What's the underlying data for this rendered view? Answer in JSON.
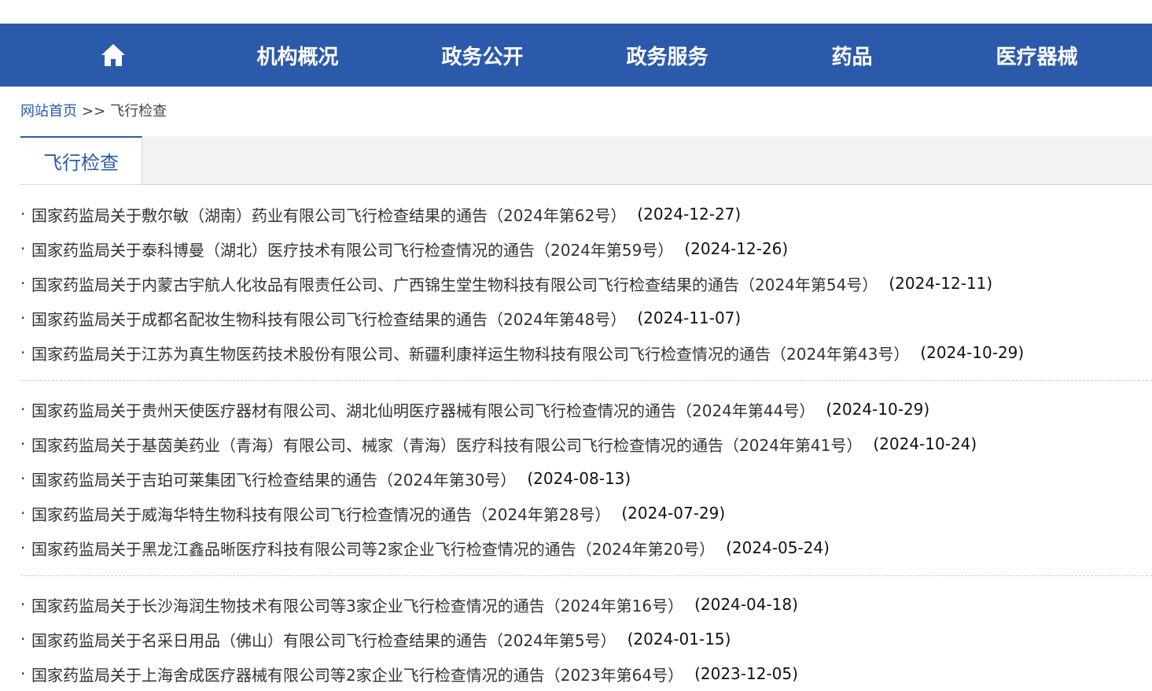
{
  "colors": {
    "accent": "#2c5aab",
    "nav_text": "#ffffff"
  },
  "nav": {
    "home_icon": "home-icon",
    "items": [
      {
        "label": "机构概况"
      },
      {
        "label": "政务公开"
      },
      {
        "label": "政务服务"
      },
      {
        "label": "药品"
      },
      {
        "label": "医疗器械"
      }
    ]
  },
  "breadcrumb": {
    "home": "网站首页",
    "separator": ">>",
    "current": "飞行检查"
  },
  "tab": {
    "label": "飞行检查"
  },
  "groups": [
    {
      "items": [
        {
          "title": "国家药监局关于敷尔敏（湖南）药业有限公司飞行检查结果的通告（2024年第62号）",
          "date": "(2024-12-27)"
        },
        {
          "title": "国家药监局关于泰科博曼（湖北）医疗技术有限公司飞行检查情况的通告（2024年第59号）",
          "date": "(2024-12-26)"
        },
        {
          "title": "国家药监局关于内蒙古宇航人化妆品有限责任公司、广西锦生堂生物科技有限公司飞行检查结果的通告（2024年第54号）",
          "date": "(2024-12-11)"
        },
        {
          "title": "国家药监局关于成都名配妆生物科技有限公司飞行检查结果的通告（2024年第48号）",
          "date": "(2024-11-07)"
        },
        {
          "title": "国家药监局关于江苏为真生物医药技术股份有限公司、新疆利康祥运生物科技有限公司飞行检查情况的通告（2024年第43号）",
          "date": "(2024-10-29)"
        }
      ]
    },
    {
      "items": [
        {
          "title": "国家药监局关于贵州天使医疗器材有限公司、湖北仙明医疗器械有限公司飞行检查情况的通告（2024年第44号）",
          "date": "(2024-10-29)"
        },
        {
          "title": "国家药监局关于基茵美药业（青海）有限公司、械家（青海）医疗科技有限公司飞行检查情况的通告（2024年第41号）",
          "date": "(2024-10-24)"
        },
        {
          "title": "国家药监局关于吉珀可莱集团飞行检查结果的通告（2024年第30号）",
          "date": "(2024-08-13)"
        },
        {
          "title": "国家药监局关于威海华特生物科技有限公司飞行检查情况的通告（2024年第28号）",
          "date": "(2024-07-29)"
        },
        {
          "title": "国家药监局关于黑龙江鑫品晰医疗科技有限公司等2家企业飞行检查情况的通告（2024年第20号）",
          "date": "(2024-05-24)"
        }
      ]
    },
    {
      "items": [
        {
          "title": "国家药监局关于长沙海润生物技术有限公司等3家企业飞行检查情况的通告（2024年第16号）",
          "date": "(2024-04-18)"
        },
        {
          "title": "国家药监局关于名采日用品（佛山）有限公司飞行检查结果的通告（2024年第5号）",
          "date": "(2024-01-15)"
        },
        {
          "title": "国家药监局关于上海舍成医疗器械有限公司等2家企业飞行检查情况的通告（2023年第64号）",
          "date": "(2023-12-05)"
        }
      ]
    }
  ]
}
